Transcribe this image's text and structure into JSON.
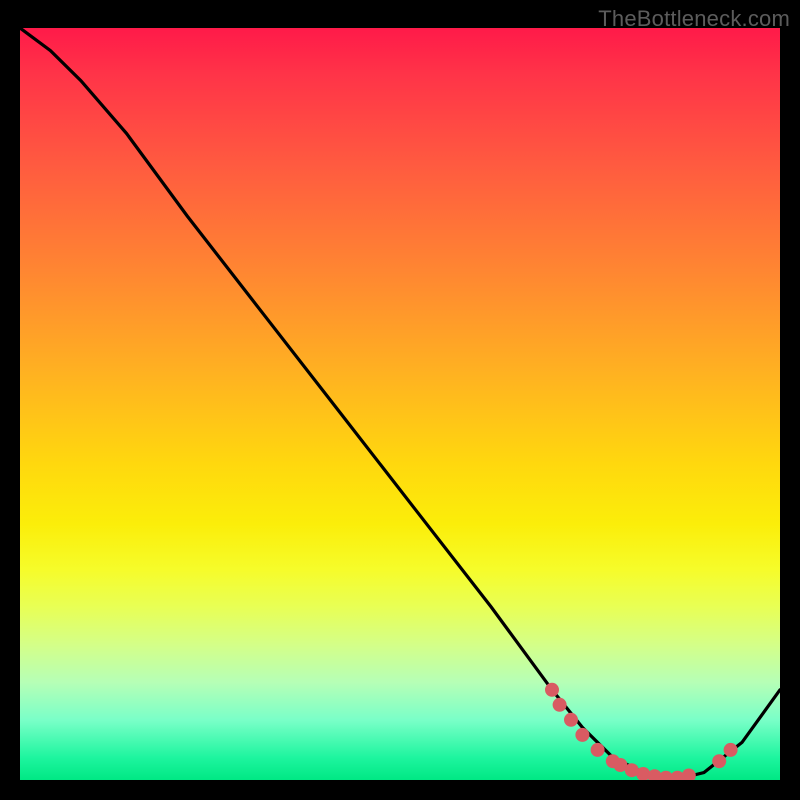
{
  "watermark": "TheBottleneck.com",
  "chart_data": {
    "type": "line",
    "title": "",
    "xlabel": "",
    "ylabel": "",
    "xlim": [
      0,
      100
    ],
    "ylim": [
      0,
      100
    ],
    "series": [
      {
        "name": "curve",
        "x": [
          0,
          4,
          8,
          14,
          22,
          32,
          42,
          52,
          62,
          70,
          74,
          78,
          82,
          86,
          90,
          95,
          100
        ],
        "y": [
          100,
          97,
          93,
          86,
          75,
          62,
          49,
          36,
          23,
          12,
          7,
          3,
          1,
          0,
          1,
          5,
          12
        ]
      }
    ],
    "markers": [
      {
        "x": 70,
        "y": 12
      },
      {
        "x": 71,
        "y": 10
      },
      {
        "x": 72.5,
        "y": 8
      },
      {
        "x": 74,
        "y": 6
      },
      {
        "x": 76,
        "y": 4
      },
      {
        "x": 78,
        "y": 2.5
      },
      {
        "x": 79,
        "y": 2
      },
      {
        "x": 80.5,
        "y": 1.3
      },
      {
        "x": 82,
        "y": 0.8
      },
      {
        "x": 83.5,
        "y": 0.5
      },
      {
        "x": 85,
        "y": 0.3
      },
      {
        "x": 86.5,
        "y": 0.3
      },
      {
        "x": 88,
        "y": 0.6
      },
      {
        "x": 92,
        "y": 2.5
      },
      {
        "x": 93.5,
        "y": 4
      }
    ],
    "colors": {
      "line": "#000000",
      "marker": "#d95b62"
    }
  }
}
